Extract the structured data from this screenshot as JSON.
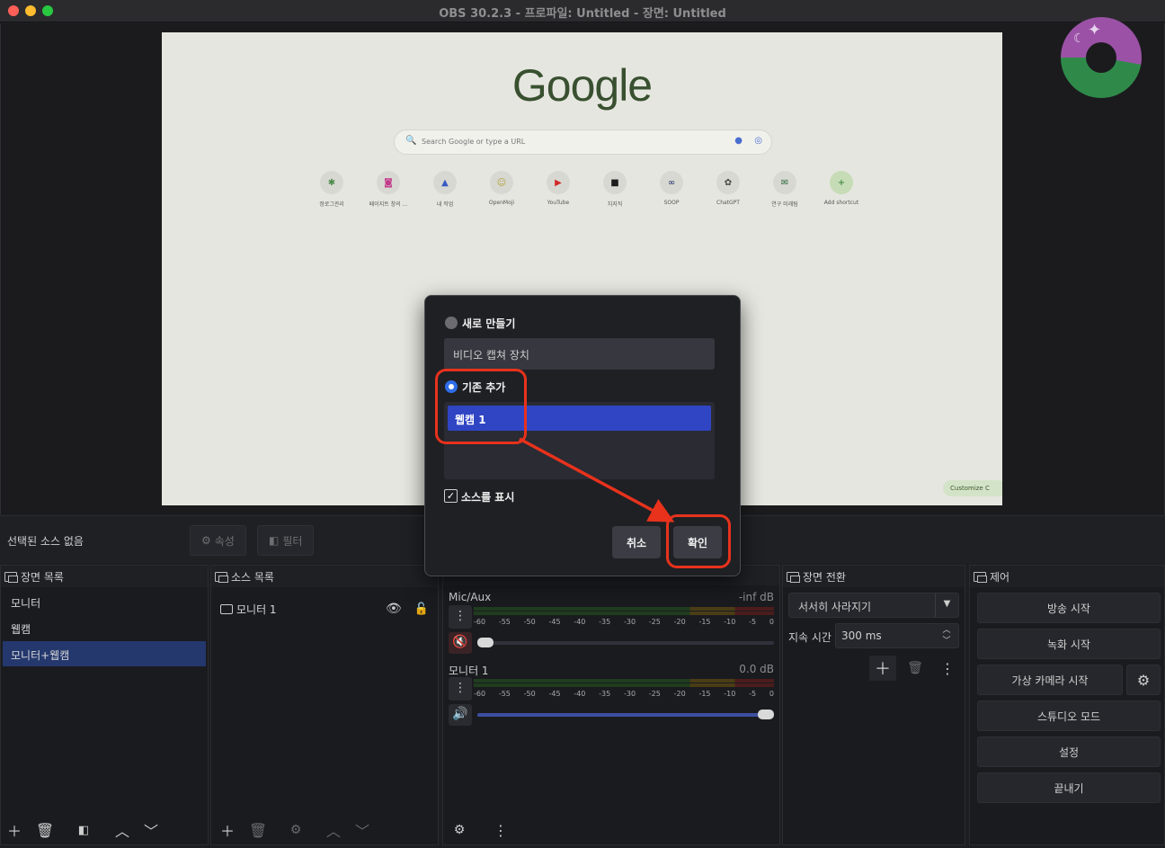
{
  "window": {
    "title": "OBS 30.2.3 - 프로파일: Untitled - 장면: Untitled"
  },
  "preview": {
    "google_logo": "Google",
    "search_placeholder": "Search Google or type a URL",
    "shortcuts": [
      "정로그관리",
      "페이지트 창의 ...",
      "내 작업",
      "OpenMoji",
      "YouTube",
      "치지직",
      "SOOP",
      "ChatGPT",
      "연구 미래팀",
      "Add shortcut"
    ],
    "customize_label": "Customize C"
  },
  "context_bar": {
    "no_source": "선택된 소스 없음",
    "properties": "속성",
    "filters": "필터"
  },
  "scenes": {
    "title": "장면 목록",
    "items": [
      "모니터",
      "웹캠",
      "모니터+웹캠"
    ],
    "selected_index": 2
  },
  "sources": {
    "title": "소스 목록",
    "items": [
      "모니터 1"
    ]
  },
  "mixer": {
    "channels": [
      {
        "name": "Mic/Aux",
        "db": "-inf dB",
        "muted": true,
        "volume": 0.0
      },
      {
        "name": "모니터 1",
        "db": "0.0 dB",
        "muted": false,
        "volume": 1.0
      }
    ],
    "scale": [
      "-60",
      "-55",
      "-50",
      "-45",
      "-40",
      "-35",
      "-30",
      "-25",
      "-20",
      "-15",
      "-10",
      "-5",
      "0"
    ]
  },
  "transitions": {
    "title": "장면 전환",
    "selected": "서서히 사라지기",
    "duration_label": "지속 시간",
    "duration_value": "300 ms"
  },
  "controls": {
    "title": "제어",
    "buttons": [
      "방송 시작",
      "녹화 시작",
      "가상 카메라 시작",
      "스튜디오 모드",
      "설정",
      "끝내기"
    ]
  },
  "dialog": {
    "new_label": "새로 만들기",
    "new_input_value": "비디오 캡쳐 장치",
    "existing_label": "기존 추가",
    "existing_items": [
      "웹캠 1"
    ],
    "visible_label": "소스를 표시",
    "cancel": "취소",
    "ok": "확인"
  },
  "colors": {
    "accent": "#2f45c4",
    "annotation": "#e8321c",
    "scene_selected": "#24386e"
  }
}
